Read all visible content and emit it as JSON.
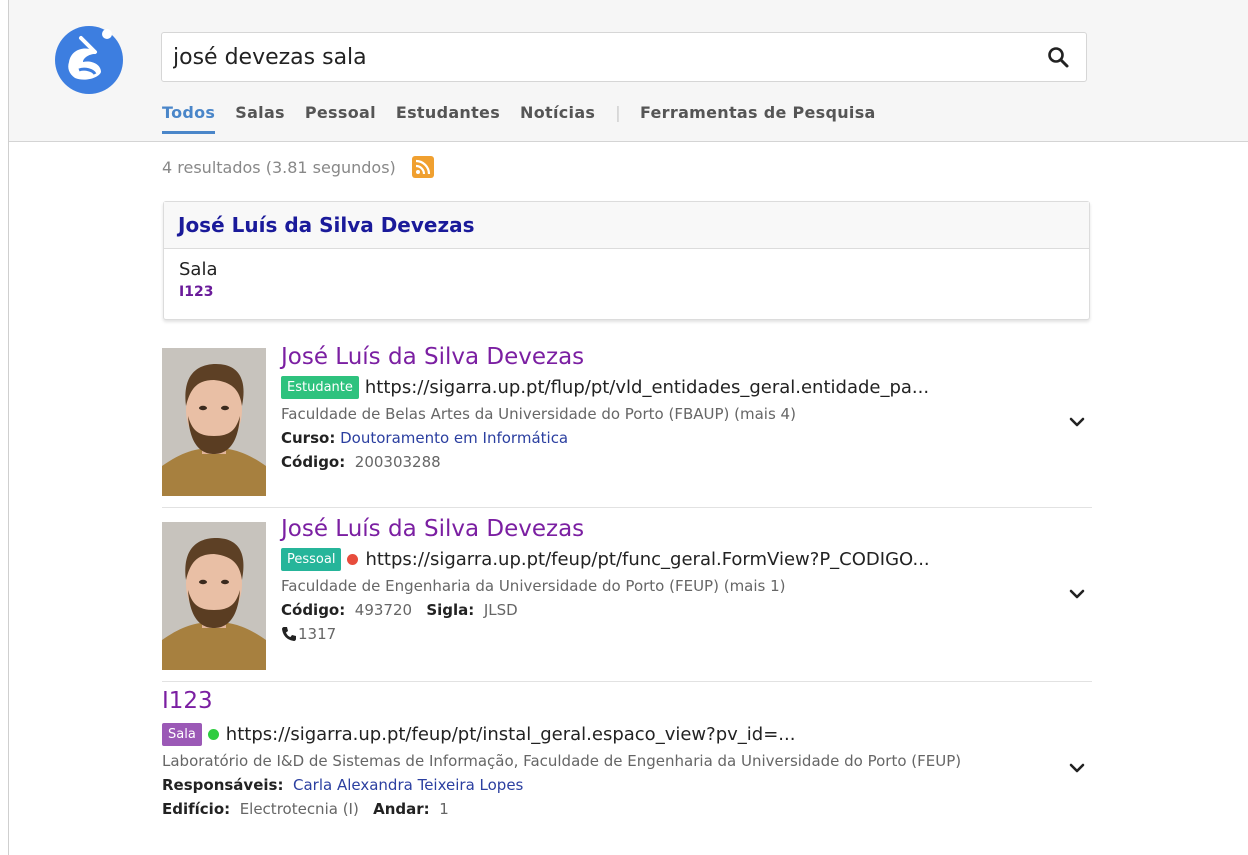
{
  "header": {
    "logo_icon": "search-logo-icon",
    "search": {
      "value": "josé devezas sala"
    },
    "search_icon": "magnifier-icon",
    "tabs": [
      {
        "label": "Todos",
        "active": true
      },
      {
        "label": "Salas"
      },
      {
        "label": "Pessoal"
      },
      {
        "label": "Estudantes"
      },
      {
        "label": "Notícias"
      }
    ],
    "tools_label": "Ferramentas de Pesquisa",
    "accent": "#4a86c9"
  },
  "stats": {
    "text": "4 resultados (3.81 segundos)",
    "rss_icon": "rss-icon"
  },
  "card": {
    "title": "José Luís da Silva Devezas",
    "label": "Sala",
    "code": "I123"
  },
  "results": [
    {
      "title": "José Luís da Silva Devezas",
      "badge": "Estudante",
      "url": "https://sigarra.up.pt/flup/pt/vld_entidades_geral.entidade_pa...",
      "description": "Faculdade de Belas Artes da Universidade do Porto (FBAUP) (mais 4)",
      "course_label": "Curso:",
      "course_value": "Doutoramento em Informática",
      "code_label": "Código:",
      "code_value": "200303288"
    },
    {
      "title": "José Luís da Silva Devezas",
      "badge": "Pessoal",
      "status_color": "#e74c3c",
      "url": "https://sigarra.up.pt/feup/pt/func_geral.FormView?P_CODIGO...",
      "description": "Faculdade de Engenharia da Universidade do Porto (FEUP) (mais 1)",
      "code_label": "Código:",
      "code_value": "493720",
      "sigla_label": "Sigla:",
      "sigla_value": "JLSD",
      "phone": "1317"
    },
    {
      "title": "I123",
      "badge": "Sala",
      "status_color": "#2ecc40",
      "url": "https://sigarra.up.pt/feup/pt/instal_geral.espaco_view?pv_id=...",
      "description": "Laboratório de I&D de Sistemas de Informação, Faculdade de Engenharia da Universidade do Porto (FEUP)",
      "resp_label": "Responsáveis:",
      "resp_value": "Carla Alexandra Teixeira Lopes",
      "building_label": "Edifício:",
      "building_value": "Electrotecnia (I)",
      "floor_label": "Andar:",
      "floor_value": "1"
    }
  ]
}
